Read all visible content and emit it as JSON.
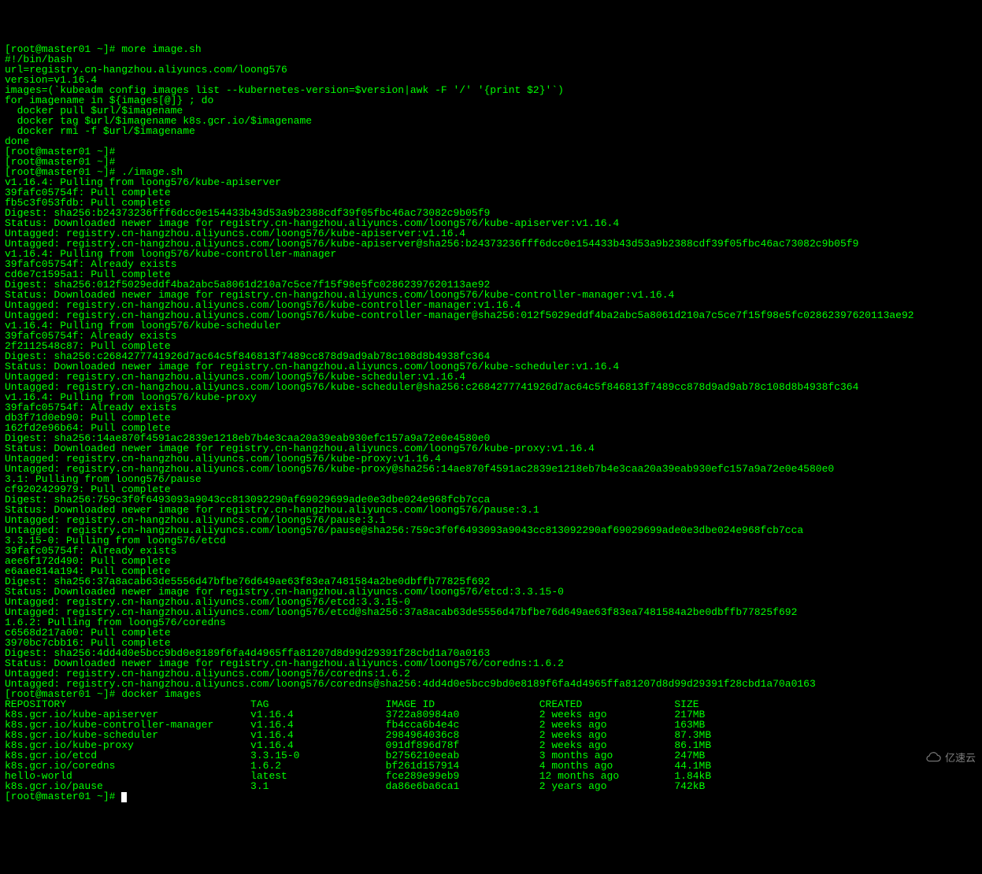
{
  "prompt": "[root@master01 ~]# ",
  "cmd_more": "more image.sh",
  "script_lines": [
    "#!/bin/bash",
    "url=registry.cn-hangzhou.aliyuncs.com/loong576",
    "version=v1.16.4",
    "images=(`kubeadm config images list --kubernetes-version=$version|awk -F '/' '{print $2}'`)",
    "for imagename in ${images[@]} ; do",
    "  docker pull $url/$imagename",
    "  docker tag $url/$imagename k8s.gcr.io/$imagename",
    "  docker rmi -f $url/$imagename",
    "done"
  ],
  "cmd_run": "./image.sh",
  "pull_lines": [
    "v1.16.4: Pulling from loong576/kube-apiserver",
    "39fafc05754f: Pull complete",
    "fb5c3f053fdb: Pull complete",
    "Digest: sha256:b24373236fff6dcc0e154433b43d53a9b2388cdf39f05fbc46ac73082c9b05f9",
    "Status: Downloaded newer image for registry.cn-hangzhou.aliyuncs.com/loong576/kube-apiserver:v1.16.4",
    "Untagged: registry.cn-hangzhou.aliyuncs.com/loong576/kube-apiserver:v1.16.4",
    "Untagged: registry.cn-hangzhou.aliyuncs.com/loong576/kube-apiserver@sha256:b24373236fff6dcc0e154433b43d53a9b2388cdf39f05fbc46ac73082c9b05f9",
    "v1.16.4: Pulling from loong576/kube-controller-manager",
    "39fafc05754f: Already exists",
    "cd6e7c1595a1: Pull complete",
    "Digest: sha256:012f5029eddf4ba2abc5a8061d210a7c5ce7f15f98e5fc02862397620113ae92",
    "Status: Downloaded newer image for registry.cn-hangzhou.aliyuncs.com/loong576/kube-controller-manager:v1.16.4",
    "Untagged: registry.cn-hangzhou.aliyuncs.com/loong576/kube-controller-manager:v1.16.4",
    "Untagged: registry.cn-hangzhou.aliyuncs.com/loong576/kube-controller-manager@sha256:012f5029eddf4ba2abc5a8061d210a7c5ce7f15f98e5fc02862397620113ae92",
    "v1.16.4: Pulling from loong576/kube-scheduler",
    "39fafc05754f: Already exists",
    "2f2112548c87: Pull complete",
    "Digest: sha256:c2684277741926d7ac64c5f846813f7489cc878d9ad9ab78c108d8b4938fc364",
    "Status: Downloaded newer image for registry.cn-hangzhou.aliyuncs.com/loong576/kube-scheduler:v1.16.4",
    "Untagged: registry.cn-hangzhou.aliyuncs.com/loong576/kube-scheduler:v1.16.4",
    "Untagged: registry.cn-hangzhou.aliyuncs.com/loong576/kube-scheduler@sha256:c2684277741926d7ac64c5f846813f7489cc878d9ad9ab78c108d8b4938fc364",
    "v1.16.4: Pulling from loong576/kube-proxy",
    "39fafc05754f: Already exists",
    "db3f71d0eb90: Pull complete",
    "162fd2e96b64: Pull complete",
    "Digest: sha256:14ae870f4591ac2839e1218eb7b4e3caa20a39eab930efc157a9a72e0e4580e0",
    "Status: Downloaded newer image for registry.cn-hangzhou.aliyuncs.com/loong576/kube-proxy:v1.16.4",
    "Untagged: registry.cn-hangzhou.aliyuncs.com/loong576/kube-proxy:v1.16.4",
    "Untagged: registry.cn-hangzhou.aliyuncs.com/loong576/kube-proxy@sha256:14ae870f4591ac2839e1218eb7b4e3caa20a39eab930efc157a9a72e0e4580e0",
    "3.1: Pulling from loong576/pause",
    "cf9202429979: Pull complete",
    "Digest: sha256:759c3f0f6493093a9043cc813092290af69029699ade0e3dbe024e968fcb7cca",
    "Status: Downloaded newer image for registry.cn-hangzhou.aliyuncs.com/loong576/pause:3.1",
    "Untagged: registry.cn-hangzhou.aliyuncs.com/loong576/pause:3.1",
    "Untagged: registry.cn-hangzhou.aliyuncs.com/loong576/pause@sha256:759c3f0f6493093a9043cc813092290af69029699ade0e3dbe024e968fcb7cca",
    "3.3.15-0: Pulling from loong576/etcd",
    "39fafc05754f: Already exists",
    "aee6f172d490: Pull complete",
    "e6aae814a194: Pull complete",
    "Digest: sha256:37a8acab63de5556d47bfbe76d649ae63f83ea7481584a2be0dbffb77825f692",
    "Status: Downloaded newer image for registry.cn-hangzhou.aliyuncs.com/loong576/etcd:3.3.15-0",
    "Untagged: registry.cn-hangzhou.aliyuncs.com/loong576/etcd:3.3.15-0",
    "Untagged: registry.cn-hangzhou.aliyuncs.com/loong576/etcd@sha256:37a8acab63de5556d47bfbe76d649ae63f83ea7481584a2be0dbffb77825f692",
    "1.6.2: Pulling from loong576/coredns",
    "c6568d217a00: Pull complete",
    "3970bc7cbb16: Pull complete",
    "Digest: sha256:4dd4d0e5bcc9bd0e8189f6fa4d4965ffa81207d8d99d29391f28cbd1a70a0163",
    "Status: Downloaded newer image for registry.cn-hangzhou.aliyuncs.com/loong576/coredns:1.6.2",
    "Untagged: registry.cn-hangzhou.aliyuncs.com/loong576/coredns:1.6.2",
    "Untagged: registry.cn-hangzhou.aliyuncs.com/loong576/coredns@sha256:4dd4d0e5bcc9bd0e8189f6fa4d4965ffa81207d8d99d29391f28cbd1a70a0163"
  ],
  "cmd_images": "docker images",
  "table_header": {
    "c1": "REPOSITORY",
    "c2": "TAG",
    "c3": "IMAGE ID",
    "c4": "CREATED",
    "c5": "SIZE"
  },
  "table_rows": [
    {
      "c1": "k8s.gcr.io/kube-apiserver",
      "c2": "v1.16.4",
      "c3": "3722a80984a0",
      "c4": "2 weeks ago",
      "c5": "217MB"
    },
    {
      "c1": "k8s.gcr.io/kube-controller-manager",
      "c2": "v1.16.4",
      "c3": "fb4cca6b4e4c",
      "c4": "2 weeks ago",
      "c5": "163MB"
    },
    {
      "c1": "k8s.gcr.io/kube-scheduler",
      "c2": "v1.16.4",
      "c3": "2984964036c8",
      "c4": "2 weeks ago",
      "c5": "87.3MB"
    },
    {
      "c1": "k8s.gcr.io/kube-proxy",
      "c2": "v1.16.4",
      "c3": "091df896d78f",
      "c4": "2 weeks ago",
      "c5": "86.1MB"
    },
    {
      "c1": "k8s.gcr.io/etcd",
      "c2": "3.3.15-0",
      "c3": "b2756210eeab",
      "c4": "3 months ago",
      "c5": "247MB"
    },
    {
      "c1": "k8s.gcr.io/coredns",
      "c2": "1.6.2",
      "c3": "bf261d157914",
      "c4": "4 months ago",
      "c5": "44.1MB"
    },
    {
      "c1": "hello-world",
      "c2": "latest",
      "c3": "fce289e99eb9",
      "c4": "12 months ago",
      "c5": "1.84kB"
    },
    {
      "c1": "k8s.gcr.io/pause",
      "c2": "3.1",
      "c3": "da86e6ba6ca1",
      "c4": "2 years ago",
      "c5": "742kB"
    }
  ],
  "watermark": "亿速云"
}
